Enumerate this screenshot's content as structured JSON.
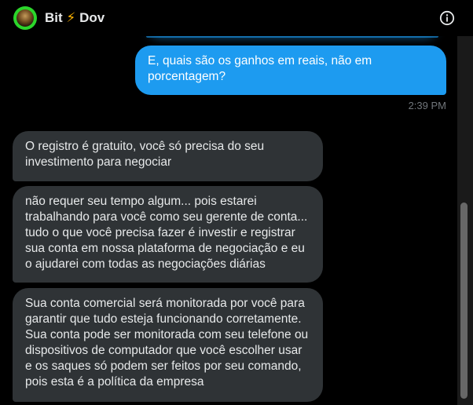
{
  "header": {
    "name_part1": "Bit",
    "name_bolt": "⚡",
    "name_part2": "Dov",
    "info_icon": "info-icon",
    "avatar_icon": "avatar"
  },
  "messages": {
    "sent": [
      {
        "lines": [
          "E, quais são os ganhos em reais, não em",
          "porcentagem?"
        ],
        "time": "2:39 PM"
      }
    ],
    "received": [
      {
        "lines": [
          "O registro é gratuito, você só precisa do seu",
          "investimento para negociar"
        ]
      },
      {
        "lines": [
          "não requer seu tempo algum... pois estarei",
          "trabalhando para você como seu gerente de conta...",
          "tudo o que você precisa fazer é investir e registrar",
          "sua conta em nossa plataforma de negociação e eu",
          "o ajudarei com todas as negociações diárias"
        ]
      },
      {
        "lines": [
          "Sua conta comercial será monitorada por você para",
          "garantir que tudo esteja funcionando corretamente.",
          "Sua conta pode ser monitorada com seu telefone ou",
          "dispositivos de computador que você escolher usar",
          "e os saques só podem ser feitos por seu comando,",
          "pois esta é a política da empresa"
        ]
      }
    ]
  },
  "colors": {
    "sent_bubble": "#1d9bf0",
    "received_bubble": "#2f3336",
    "background": "#000000",
    "accent_bolt": "#ffb400"
  }
}
